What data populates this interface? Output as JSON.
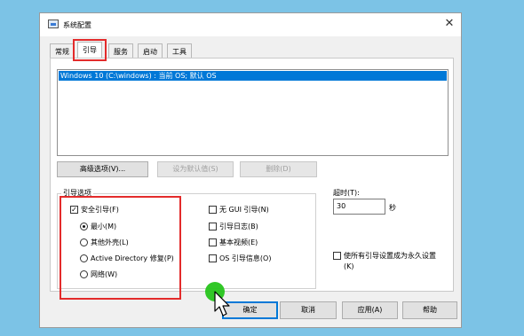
{
  "window": {
    "title": "系统配置",
    "close_glyph": "✕"
  },
  "tabs": [
    {
      "label": "常规"
    },
    {
      "label": "引导"
    },
    {
      "label": "服务"
    },
    {
      "label": "启动"
    },
    {
      "label": "工具"
    }
  ],
  "os_list": {
    "items": [
      "Windows 10 (C:\\windows) : 当前 OS; 默认 OS"
    ]
  },
  "buttons": {
    "advanced": "高级选项(V)...",
    "set_default": "设为默认值(S)",
    "delete": "删除(D)",
    "ok": "确定",
    "cancel": "取消",
    "apply": "应用(A)",
    "help": "帮助"
  },
  "boot_options": {
    "label": "引导选项",
    "safe_boot": "安全引导(F)",
    "safe_boot_checked": true,
    "radios": [
      {
        "label": "最小(M)",
        "selected": true
      },
      {
        "label": "其他外壳(L)",
        "selected": false
      },
      {
        "label": "Active Directory 修复(P)",
        "selected": false
      },
      {
        "label": "网络(W)",
        "selected": false
      }
    ],
    "checks": [
      {
        "label": "无 GUI 引导(N)",
        "checked": false
      },
      {
        "label": "引导日志(B)",
        "checked": false
      },
      {
        "label": "基本视频(E)",
        "checked": false
      },
      {
        "label": "OS 引导信息(O)",
        "checked": false
      }
    ]
  },
  "timeout": {
    "label": "超时(T):",
    "value": "30",
    "unit": "秒"
  },
  "permanent": {
    "line1": "使所有引导设置成为永久设置",
    "line2": "(K)",
    "checked": false
  },
  "colors": {
    "highlight": "#e32b2b",
    "cursor_marker": "#26c41b",
    "selection": "#0078d7"
  }
}
